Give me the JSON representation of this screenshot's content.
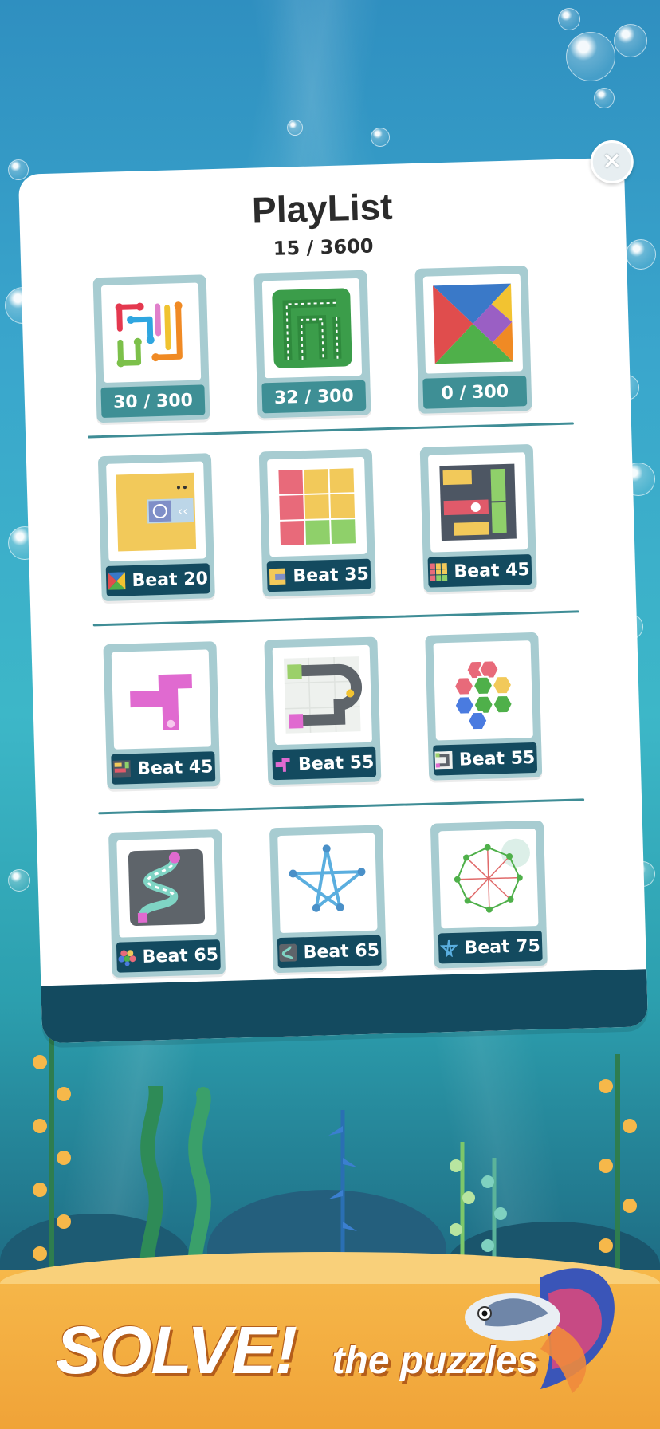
{
  "playlist": {
    "title": "PlayList",
    "progress": "15 / 3600",
    "close_icon": "×"
  },
  "rows": [
    [
      {
        "label": "30 / 300",
        "icon": "flow-lines-puzzle-icon",
        "type": "progress"
      },
      {
        "label": "32 / 300",
        "icon": "maze-path-puzzle-icon",
        "type": "progress"
      },
      {
        "label": "0 / 300",
        "icon": "tangram-puzzle-icon",
        "type": "progress"
      }
    ],
    [
      {
        "label": "Beat 20",
        "icon": "slide-block-puzzle-icon",
        "type": "beat",
        "badge": "tangram-mini-icon"
      },
      {
        "label": "Beat 35",
        "icon": "color-grid-puzzle-icon",
        "type": "beat",
        "badge": "slide-block-mini-icon"
      },
      {
        "label": "Beat 45",
        "icon": "unblock-puzzle-icon",
        "type": "beat",
        "badge": "color-grid-mini-icon"
      }
    ],
    [
      {
        "label": "Beat 45",
        "icon": "paint-fill-puzzle-icon",
        "type": "beat",
        "badge": "unblock-mini-icon"
      },
      {
        "label": "Beat 55",
        "icon": "pipe-connect-puzzle-icon",
        "type": "beat",
        "badge": "paint-mini-icon"
      },
      {
        "label": "Beat 55",
        "icon": "hexagon-puzzle-icon",
        "type": "beat",
        "badge": "pipe-mini-icon"
      }
    ],
    [
      {
        "label": "Beat 65",
        "icon": "water-pipe-puzzle-icon",
        "type": "beat",
        "badge": "hexagon-mini-icon"
      },
      {
        "label": "Beat 65",
        "icon": "star-one-line-puzzle-icon",
        "type": "beat",
        "badge": "water-pipe-mini-icon"
      },
      {
        "label": "Beat 75",
        "icon": "circle-connect-puzzle-icon",
        "type": "beat",
        "badge": "star-mini-icon"
      }
    ]
  ],
  "banner": {
    "big": "SOLVE!",
    "small": "the puzzles"
  }
}
